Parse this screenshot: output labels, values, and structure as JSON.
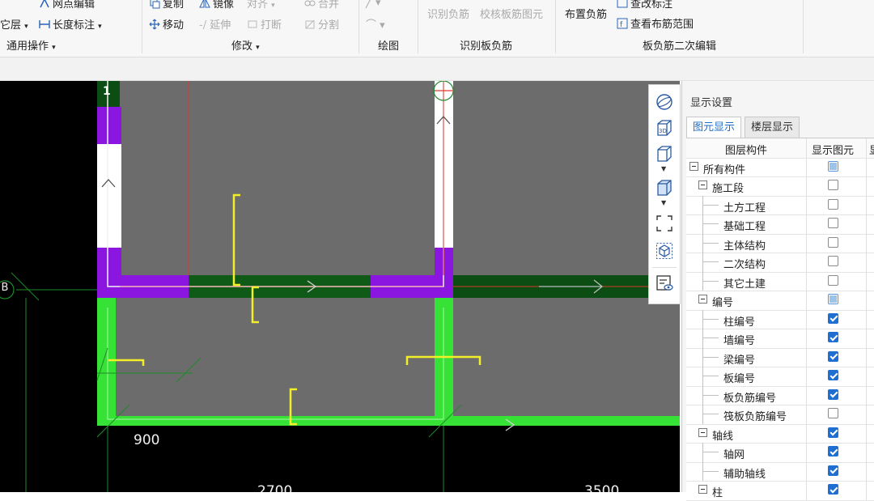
{
  "ribbon": {
    "row1": {
      "grid_edit": "网点编辑",
      "copy": "复制",
      "mirror": "镜像",
      "align": "对齐",
      "merge": "合并",
      "recognize_neg": "识别负筋",
      "check_slab": "校核板筋图元",
      "modify_label": "查改标注"
    },
    "row2": {
      "layer": "它层",
      "length_dim": "长度标注",
      "move": "移动",
      "extend": "延伸",
      "break": "打断",
      "split": "分割",
      "place_neg": "布置负筋",
      "view_range": "查看布筋范围"
    },
    "groups": {
      "general": "通用操作",
      "modify": "修改",
      "draw": "绘图",
      "recognize": "识别板负筋",
      "second_edit": "板负筋二次编辑"
    }
  },
  "canvas": {
    "axis_b": "B",
    "dims": [
      "900",
      "2700",
      "3500"
    ],
    "slab_mark": "1"
  },
  "toolbar": {
    "icons": [
      "orbit-icon",
      "3d-view-icon",
      "cube-view-icon",
      "cube-solid-icon",
      "select-region-icon",
      "layer-cube-icon",
      "display-settings-icon"
    ]
  },
  "panel": {
    "title": "显示设置",
    "tabs": [
      "图元显示",
      "楼层显示"
    ],
    "columns": [
      "图层构件",
      "显示图元",
      "显"
    ],
    "rows": [
      {
        "label": "所有构件",
        "level": 0,
        "expander": true,
        "state": "part"
      },
      {
        "label": "施工段",
        "level": 1,
        "expander": true,
        "state": "off"
      },
      {
        "label": "土方工程",
        "level": 2,
        "expander": false,
        "state": "off"
      },
      {
        "label": "基础工程",
        "level": 2,
        "expander": false,
        "state": "off"
      },
      {
        "label": "主体结构",
        "level": 2,
        "expander": false,
        "state": "off"
      },
      {
        "label": "二次结构",
        "level": 2,
        "expander": false,
        "state": "off"
      },
      {
        "label": "其它土建",
        "level": 2,
        "expander": false,
        "state": "off"
      },
      {
        "label": "编号",
        "level": 1,
        "expander": true,
        "state": "part"
      },
      {
        "label": "柱编号",
        "level": 2,
        "expander": false,
        "state": "on"
      },
      {
        "label": "墙编号",
        "level": 2,
        "expander": false,
        "state": "on"
      },
      {
        "label": "梁编号",
        "level": 2,
        "expander": false,
        "state": "on"
      },
      {
        "label": "板编号",
        "level": 2,
        "expander": false,
        "state": "on"
      },
      {
        "label": "板负筋编号",
        "level": 2,
        "expander": false,
        "state": "on"
      },
      {
        "label": "筏板负筋编号",
        "level": 2,
        "expander": false,
        "state": "off"
      },
      {
        "label": "轴线",
        "level": 1,
        "expander": true,
        "state": "on"
      },
      {
        "label": "轴网",
        "level": 2,
        "expander": false,
        "state": "on"
      },
      {
        "label": "辅助轴线",
        "level": 2,
        "expander": false,
        "state": "on"
      },
      {
        "label": "柱",
        "level": 1,
        "expander": true,
        "state": "on"
      }
    ]
  }
}
